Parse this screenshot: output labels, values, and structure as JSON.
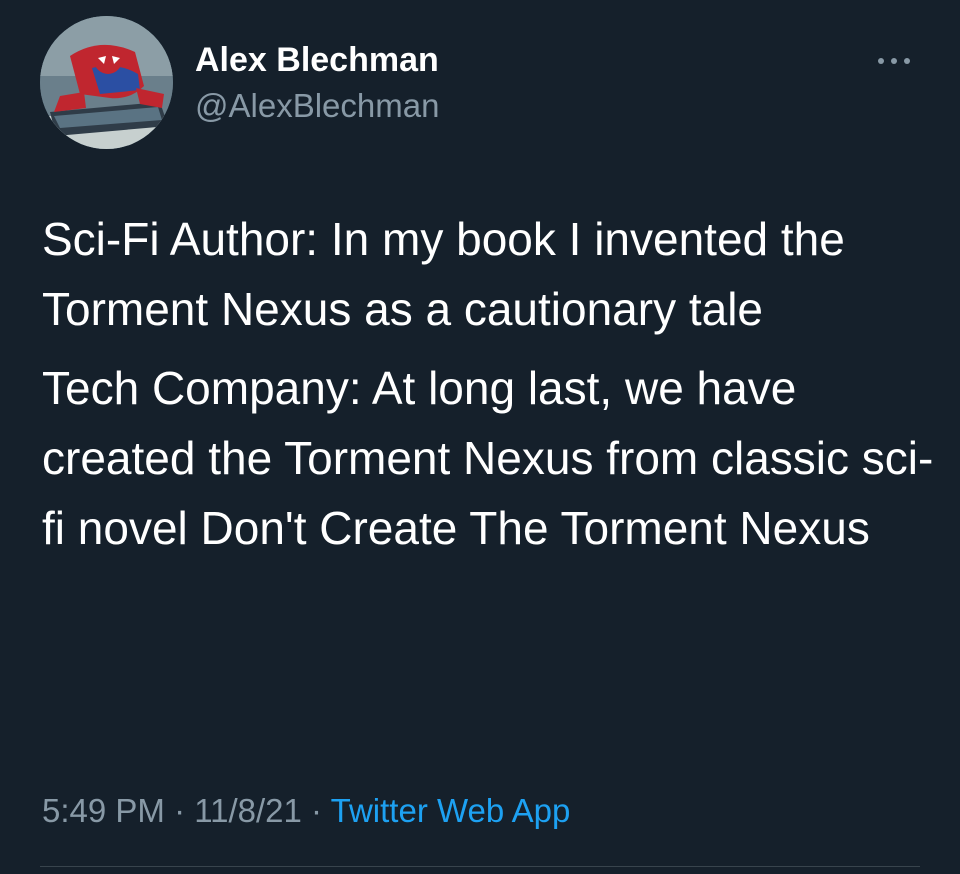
{
  "author": {
    "display_name": "Alex Blechman",
    "handle": "@AlexBlechman",
    "avatar_icon": "spider-man-avatar"
  },
  "tweet": {
    "paragraphs": [
      "Sci-Fi Author: In my book I invented the Torment Nexus as a cautionary tale",
      "Tech Company: At long last, we have created the Torment Nexus from classic sci-fi novel Don't Create The Torment Nexus"
    ]
  },
  "meta": {
    "time": "5:49 PM",
    "separator": " · ",
    "date": "11/8/21",
    "source": "Twitter Web App"
  },
  "colors": {
    "background": "#15202b",
    "text": "#ffffff",
    "secondary_text": "#8899a6",
    "link": "#1da1f2",
    "divider": "#38444d"
  },
  "icons": {
    "more": "more-horizontal-icon"
  }
}
